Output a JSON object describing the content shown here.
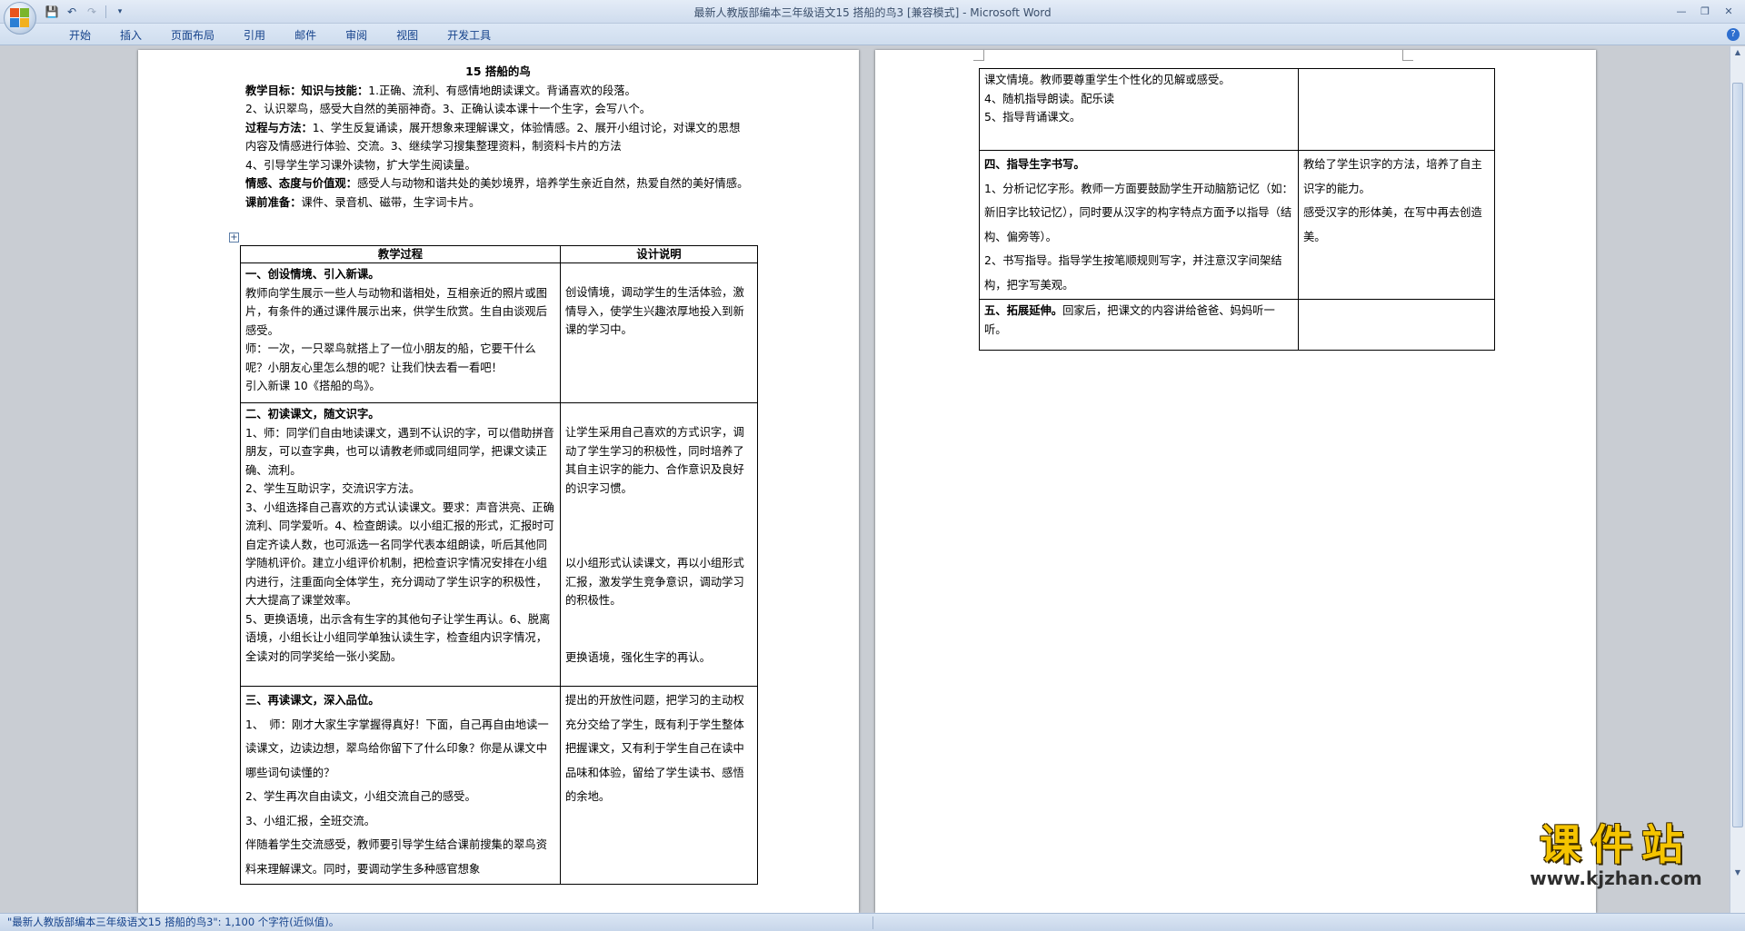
{
  "window": {
    "title": "最新人教版部编本三年级语文15 搭船的鸟3 [兼容模式] - Microsoft Word"
  },
  "qat": {
    "save_icon": "save-icon",
    "undo_icon": "undo-icon",
    "redo_icon": "redo-icon",
    "customize_icon": "chevron-down-icon"
  },
  "ribbon": {
    "tabs": [
      "开始",
      "插入",
      "页面布局",
      "引用",
      "邮件",
      "审阅",
      "视图",
      "开发工具"
    ]
  },
  "document": {
    "title": "15 搭船的鸟",
    "goals": {
      "label": "教学目标：知识与技能：",
      "text1": "1.正确、流利、有感情地朗读课文。背诵喜欢的段落。",
      "text2": "2、认识翠鸟，感受大自然的美丽神奇。3、正确认读本课十一个生字，会写八个。",
      "process_label": "过程与方法：",
      "process_text": "1、学生反复诵读，展开想象来理解课文，体验情感。2、展开小组讨论，对课文的思想内容及情感进行体验、交流。3、继续学习搜集整理资料，制资料卡片的方法",
      "process_text2": "4、引导学生学习课外读物，扩大学生阅读量。",
      "emotion_label": "情感、态度与价值观：",
      "emotion_text": "感受人与动物和谐共处的美妙境界，培养学生亲近自然，热爱自然的美好情感。",
      "prep_label": "课前准备：",
      "prep_text": "课件、录音机、磁带，生字词卡片。"
    },
    "table_headers": {
      "process": "教学过程",
      "design": "设计说明"
    },
    "rows": [
      {
        "heading": "一、创设情境、引入新课。",
        "lines": [
          "教师向学生展示一些人与动物和谐相处，互相亲近的照片或图片，有条件的通过课件展示出来，供学生欣赏。生自由谈观后感受。",
          "师：一次，一只翠鸟就搭上了一位小朋友的船，它要干什么呢？小朋友心里怎么想的呢？让我们快去看一看吧！",
          "引入新课 10《搭船的鸟》。"
        ],
        "design": [
          "创设情境，调动学生的生活体验，激情导入，使学生兴趣浓厚地投入到新课的学习中。"
        ]
      },
      {
        "heading": "二、初读课文，随文识字。",
        "lines": [
          "1、师：同学们自由地读课文，遇到不认识的字，可以借助拼音朋友，可以查字典，也可以请教老师或同组同学，把课文读正确、流利。",
          "2、学生互助识字，交流识字方法。",
          "3、小组选择自己喜欢的方式认读课文。要求：声音洪亮、正确流利、同学爱听。4、检查朗读。以小组汇报的形式，汇报时可自定齐读人数，也可派选一名同学代表本组朗读，听后其他同学随机评价。建立小组评价机制，把检查识字情况安排在小组内进行，注重面向全体学生，充分调动了学生识字的积极性，大大提高了课堂效率。",
          "5、更换语境，出示含有生字的其他句子让学生再认。6、脱离语境，小组长让小组同学单独认读生字，检查组内识字情况，全读对的同学奖给一张小奖励。"
        ],
        "design": [
          "让学生采用自己喜欢的方式识字，调动了学生学习的积极性，同时培养了其自主识字的能力、合作意识及良好的识字习惯。",
          "以小组形式认读课文，再以小组形式汇报，激发学生竞争意识，调动学习的积极性。",
          "更换语境，强化生字的再认。"
        ]
      },
      {
        "heading": "三、再读课文，深入品位。",
        "lines": [
          "1、　师：刚才大家生字掌握得真好！下面，自己再自由地读一读课文，边读边想，翠鸟给你留下了什么印象？你是从课文中哪些词句读懂的？",
          "2、学生再次自由读文，小组交流自己的感受。",
          "3、小组汇报，全班交流。",
          "伴随着学生交流感受，教师要引导学生结合课前搜集的翠鸟资料来理解课文。同时，要调动学生多种感官想象"
        ],
        "design": [
          "提出的开放性问题，把学习的主动权充分交给了学生，既有利于学生整体把握课文，又有利于学生自己在读中品味和体验，留给了学生读书、感悟的余地。"
        ]
      }
    ],
    "right_rows": [
      {
        "lines": [
          "课文情境。教师要尊重学生个性化的见解或感受。",
          "4、随机指导朗读。配乐读",
          "5、指导背诵课文。"
        ],
        "design": []
      },
      {
        "heading": "四、指导生字书写。",
        "lines": [
          "1、分析记忆字形。教师一方面要鼓励学生开动脑筋记忆（如：新旧字比较记忆），同时要从汉字的构字特点方面予以指导（结构、偏旁等）。",
          "2、书写指导。指导学生按笔顺规则写字，并注意汉字间架结构，把字写美观。"
        ],
        "design": [
          "教给了学生识字的方法，培养了自主识字的能力。",
          "感受汉字的形体美，在写中再去创造美。"
        ]
      },
      {
        "heading": "五、拓展延伸。",
        "text": "回家后，把课文的内容讲给爸爸、妈妈听一听。",
        "design": []
      }
    ]
  },
  "statusbar": {
    "text": "\"最新人教版部编本三年级语文15 搭船的鸟3\": 1,100 个字符(近似值)。"
  },
  "watermark": {
    "main": "课件站",
    "url": "www.kjzhan.com"
  }
}
